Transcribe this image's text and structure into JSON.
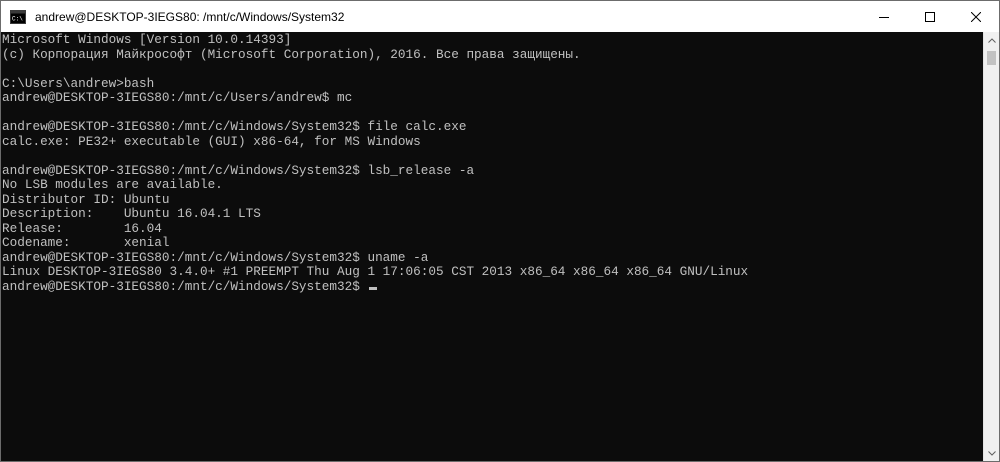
{
  "window": {
    "title": "andrew@DESKTOP-3IEGS80: /mnt/c/Windows/System32",
    "app_icon": "console-icon",
    "minimize_icon": "minimize-icon",
    "maximize_icon": "maximize-icon",
    "close_icon": "close-icon"
  },
  "console": {
    "lines": [
      "Microsoft Windows [Version 10.0.14393]",
      "(c) Корпорация Майкрософт (Microsoft Corporation), 2016. Все права защищены.",
      "",
      "C:\\Users\\andrew>bash",
      "andrew@DESKTOP-3IEGS80:/mnt/c/Users/andrew$ mc",
      "",
      "andrew@DESKTOP-3IEGS80:/mnt/c/Windows/System32$ file calc.exe",
      "calc.exe: PE32+ executable (GUI) x86-64, for MS Windows",
      "",
      "andrew@DESKTOP-3IEGS80:/mnt/c/Windows/System32$ lsb_release -a",
      "No LSB modules are available.",
      "Distributor ID: Ubuntu",
      "Description:    Ubuntu 16.04.1 LTS",
      "Release:        16.04",
      "Codename:       xenial",
      "andrew@DESKTOP-3IEGS80:/mnt/c/Windows/System32$ uname -a",
      "Linux DESKTOP-3IEGS80 3.4.0+ #1 PREEMPT Thu Aug 1 17:06:05 CST 2013 x86_64 x86_64 x86_64 GNU/Linux"
    ],
    "prompt": "andrew@DESKTOP-3IEGS80:/mnt/c/Windows/System32$ ",
    "colors": {
      "background": "#0c0c0c",
      "foreground": "#c0c0c0"
    }
  },
  "scrollbar": {
    "up_icon": "scroll-up-arrow-icon",
    "down_icon": "scroll-down-arrow-icon"
  }
}
